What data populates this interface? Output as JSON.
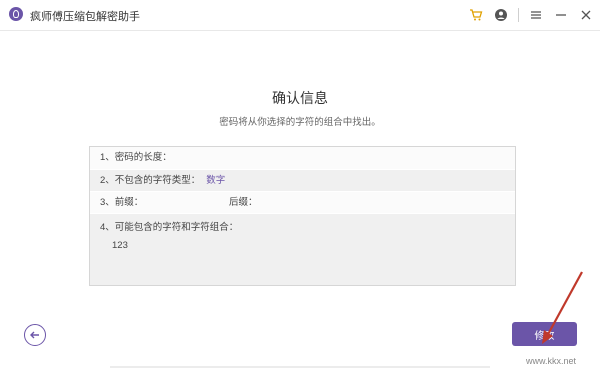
{
  "app": {
    "title": "疯师傅压缩包解密助手"
  },
  "titlebar": {
    "icons": [
      "cart-icon",
      "account-icon",
      "menu-icon",
      "minimize-icon",
      "close-icon"
    ]
  },
  "page": {
    "heading": "确认信息",
    "subtitle": "密码将从你选择的字符的组合中找出。"
  },
  "info": {
    "rows": [
      {
        "label": "1、密码的长度：",
        "value": ""
      },
      {
        "label": "2、不包含的字符类型：",
        "value": "数字"
      },
      {
        "label": "3、前缀：",
        "value": "",
        "later_label": "后缀："
      },
      {
        "label": "4、可能包含的字符和字符组合：",
        "value": "123"
      }
    ]
  },
  "buttons": {
    "next": "修改"
  },
  "colors": {
    "accent": "#6b55a8",
    "annotation": "#c0392b"
  },
  "watermark": "www.kkx.net"
}
